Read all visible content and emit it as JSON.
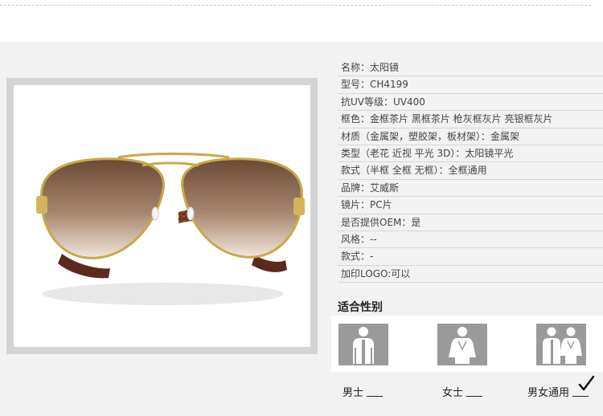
{
  "specs": [
    {
      "label": "名称：太阳镜"
    },
    {
      "label": "型号：CH4199"
    },
    {
      "label": "抗UV等级：UV400"
    },
    {
      "label": "框色：金框茶片 黑框茶片 枪灰框灰片 亮银框灰片"
    },
    {
      "label": "材质（金属架，塑胶架，板材架）：金属架"
    },
    {
      "label": "类型（老花 近视 平光 3D）：太阳镜平光"
    },
    {
      "label": "款式（半框 全框 无框）：全框通用"
    },
    {
      "label": "品牌：艾威斯"
    },
    {
      "label": "镜片：PC片"
    },
    {
      "label": "是否提供OEM：是"
    },
    {
      "label": "风格：--"
    },
    {
      "label": "款式：-"
    },
    {
      "label": "加印LOGO:可以"
    }
  ],
  "gender": {
    "title": "适合性别",
    "options": [
      {
        "label": "男士",
        "icon": "male-figure-icon",
        "selected": false
      },
      {
        "label": "女士",
        "icon": "female-figure-icon",
        "selected": false
      },
      {
        "label": "男女通用",
        "icon": "unisex-figures-icon",
        "selected": true
      }
    ]
  },
  "product_image": {
    "subject": "aviator-sunglasses",
    "lens_color": "#8a6a52",
    "frame_color": "#c9a84a",
    "temple_color": "#7a3d2a"
  }
}
